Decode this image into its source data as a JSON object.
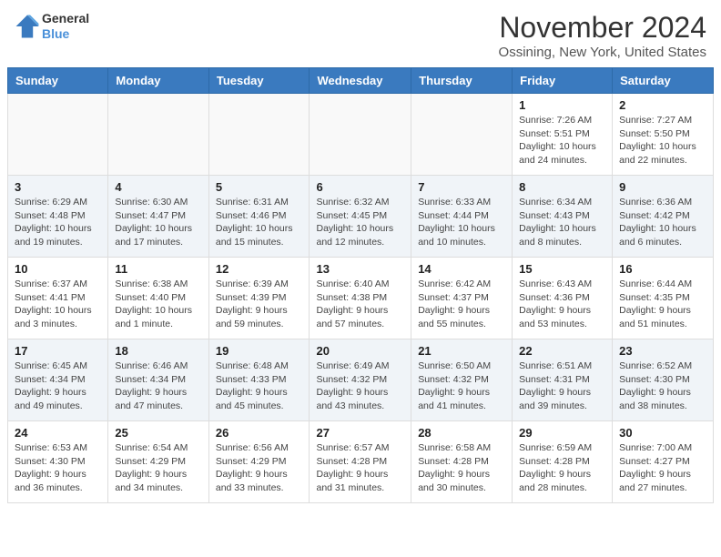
{
  "header": {
    "logo_line1": "General",
    "logo_line2": "Blue",
    "month_title": "November 2024",
    "location": "Ossining, New York, United States"
  },
  "days_of_week": [
    "Sunday",
    "Monday",
    "Tuesday",
    "Wednesday",
    "Thursday",
    "Friday",
    "Saturday"
  ],
  "weeks": [
    [
      {
        "day": "",
        "info": ""
      },
      {
        "day": "",
        "info": ""
      },
      {
        "day": "",
        "info": ""
      },
      {
        "day": "",
        "info": ""
      },
      {
        "day": "",
        "info": ""
      },
      {
        "day": "1",
        "info": "Sunrise: 7:26 AM\nSunset: 5:51 PM\nDaylight: 10 hours and 24 minutes."
      },
      {
        "day": "2",
        "info": "Sunrise: 7:27 AM\nSunset: 5:50 PM\nDaylight: 10 hours and 22 minutes."
      }
    ],
    [
      {
        "day": "3",
        "info": "Sunrise: 6:29 AM\nSunset: 4:48 PM\nDaylight: 10 hours and 19 minutes."
      },
      {
        "day": "4",
        "info": "Sunrise: 6:30 AM\nSunset: 4:47 PM\nDaylight: 10 hours and 17 minutes."
      },
      {
        "day": "5",
        "info": "Sunrise: 6:31 AM\nSunset: 4:46 PM\nDaylight: 10 hours and 15 minutes."
      },
      {
        "day": "6",
        "info": "Sunrise: 6:32 AM\nSunset: 4:45 PM\nDaylight: 10 hours and 12 minutes."
      },
      {
        "day": "7",
        "info": "Sunrise: 6:33 AM\nSunset: 4:44 PM\nDaylight: 10 hours and 10 minutes."
      },
      {
        "day": "8",
        "info": "Sunrise: 6:34 AM\nSunset: 4:43 PM\nDaylight: 10 hours and 8 minutes."
      },
      {
        "day": "9",
        "info": "Sunrise: 6:36 AM\nSunset: 4:42 PM\nDaylight: 10 hours and 6 minutes."
      }
    ],
    [
      {
        "day": "10",
        "info": "Sunrise: 6:37 AM\nSunset: 4:41 PM\nDaylight: 10 hours and 3 minutes."
      },
      {
        "day": "11",
        "info": "Sunrise: 6:38 AM\nSunset: 4:40 PM\nDaylight: 10 hours and 1 minute."
      },
      {
        "day": "12",
        "info": "Sunrise: 6:39 AM\nSunset: 4:39 PM\nDaylight: 9 hours and 59 minutes."
      },
      {
        "day": "13",
        "info": "Sunrise: 6:40 AM\nSunset: 4:38 PM\nDaylight: 9 hours and 57 minutes."
      },
      {
        "day": "14",
        "info": "Sunrise: 6:42 AM\nSunset: 4:37 PM\nDaylight: 9 hours and 55 minutes."
      },
      {
        "day": "15",
        "info": "Sunrise: 6:43 AM\nSunset: 4:36 PM\nDaylight: 9 hours and 53 minutes."
      },
      {
        "day": "16",
        "info": "Sunrise: 6:44 AM\nSunset: 4:35 PM\nDaylight: 9 hours and 51 minutes."
      }
    ],
    [
      {
        "day": "17",
        "info": "Sunrise: 6:45 AM\nSunset: 4:34 PM\nDaylight: 9 hours and 49 minutes."
      },
      {
        "day": "18",
        "info": "Sunrise: 6:46 AM\nSunset: 4:34 PM\nDaylight: 9 hours and 47 minutes."
      },
      {
        "day": "19",
        "info": "Sunrise: 6:48 AM\nSunset: 4:33 PM\nDaylight: 9 hours and 45 minutes."
      },
      {
        "day": "20",
        "info": "Sunrise: 6:49 AM\nSunset: 4:32 PM\nDaylight: 9 hours and 43 minutes."
      },
      {
        "day": "21",
        "info": "Sunrise: 6:50 AM\nSunset: 4:32 PM\nDaylight: 9 hours and 41 minutes."
      },
      {
        "day": "22",
        "info": "Sunrise: 6:51 AM\nSunset: 4:31 PM\nDaylight: 9 hours and 39 minutes."
      },
      {
        "day": "23",
        "info": "Sunrise: 6:52 AM\nSunset: 4:30 PM\nDaylight: 9 hours and 38 minutes."
      }
    ],
    [
      {
        "day": "24",
        "info": "Sunrise: 6:53 AM\nSunset: 4:30 PM\nDaylight: 9 hours and 36 minutes."
      },
      {
        "day": "25",
        "info": "Sunrise: 6:54 AM\nSunset: 4:29 PM\nDaylight: 9 hours and 34 minutes."
      },
      {
        "day": "26",
        "info": "Sunrise: 6:56 AM\nSunset: 4:29 PM\nDaylight: 9 hours and 33 minutes."
      },
      {
        "day": "27",
        "info": "Sunrise: 6:57 AM\nSunset: 4:28 PM\nDaylight: 9 hours and 31 minutes."
      },
      {
        "day": "28",
        "info": "Sunrise: 6:58 AM\nSunset: 4:28 PM\nDaylight: 9 hours and 30 minutes."
      },
      {
        "day": "29",
        "info": "Sunrise: 6:59 AM\nSunset: 4:28 PM\nDaylight: 9 hours and 28 minutes."
      },
      {
        "day": "30",
        "info": "Sunrise: 7:00 AM\nSunset: 4:27 PM\nDaylight: 9 hours and 27 minutes."
      }
    ]
  ]
}
